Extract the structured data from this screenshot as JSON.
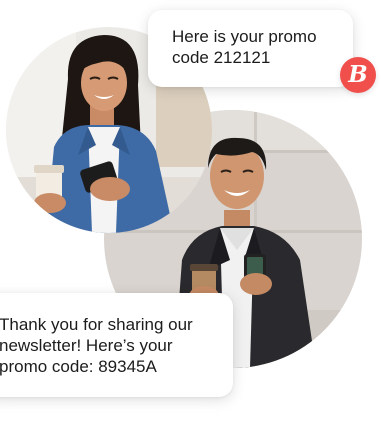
{
  "messages": {
    "promo_message": "Here is your promo\ncode 212121",
    "newsletter_message": "Thank you for sharing our\nnewsletter! Here’s your\npromo code: 89345A"
  },
  "brand": {
    "badge_letter": "B",
    "badge_color": "#f14f4b"
  },
  "images": {
    "woman_photo": "woman-smiling-at-phone-photo",
    "man_photo": "man-smiling-at-phone-photo"
  }
}
